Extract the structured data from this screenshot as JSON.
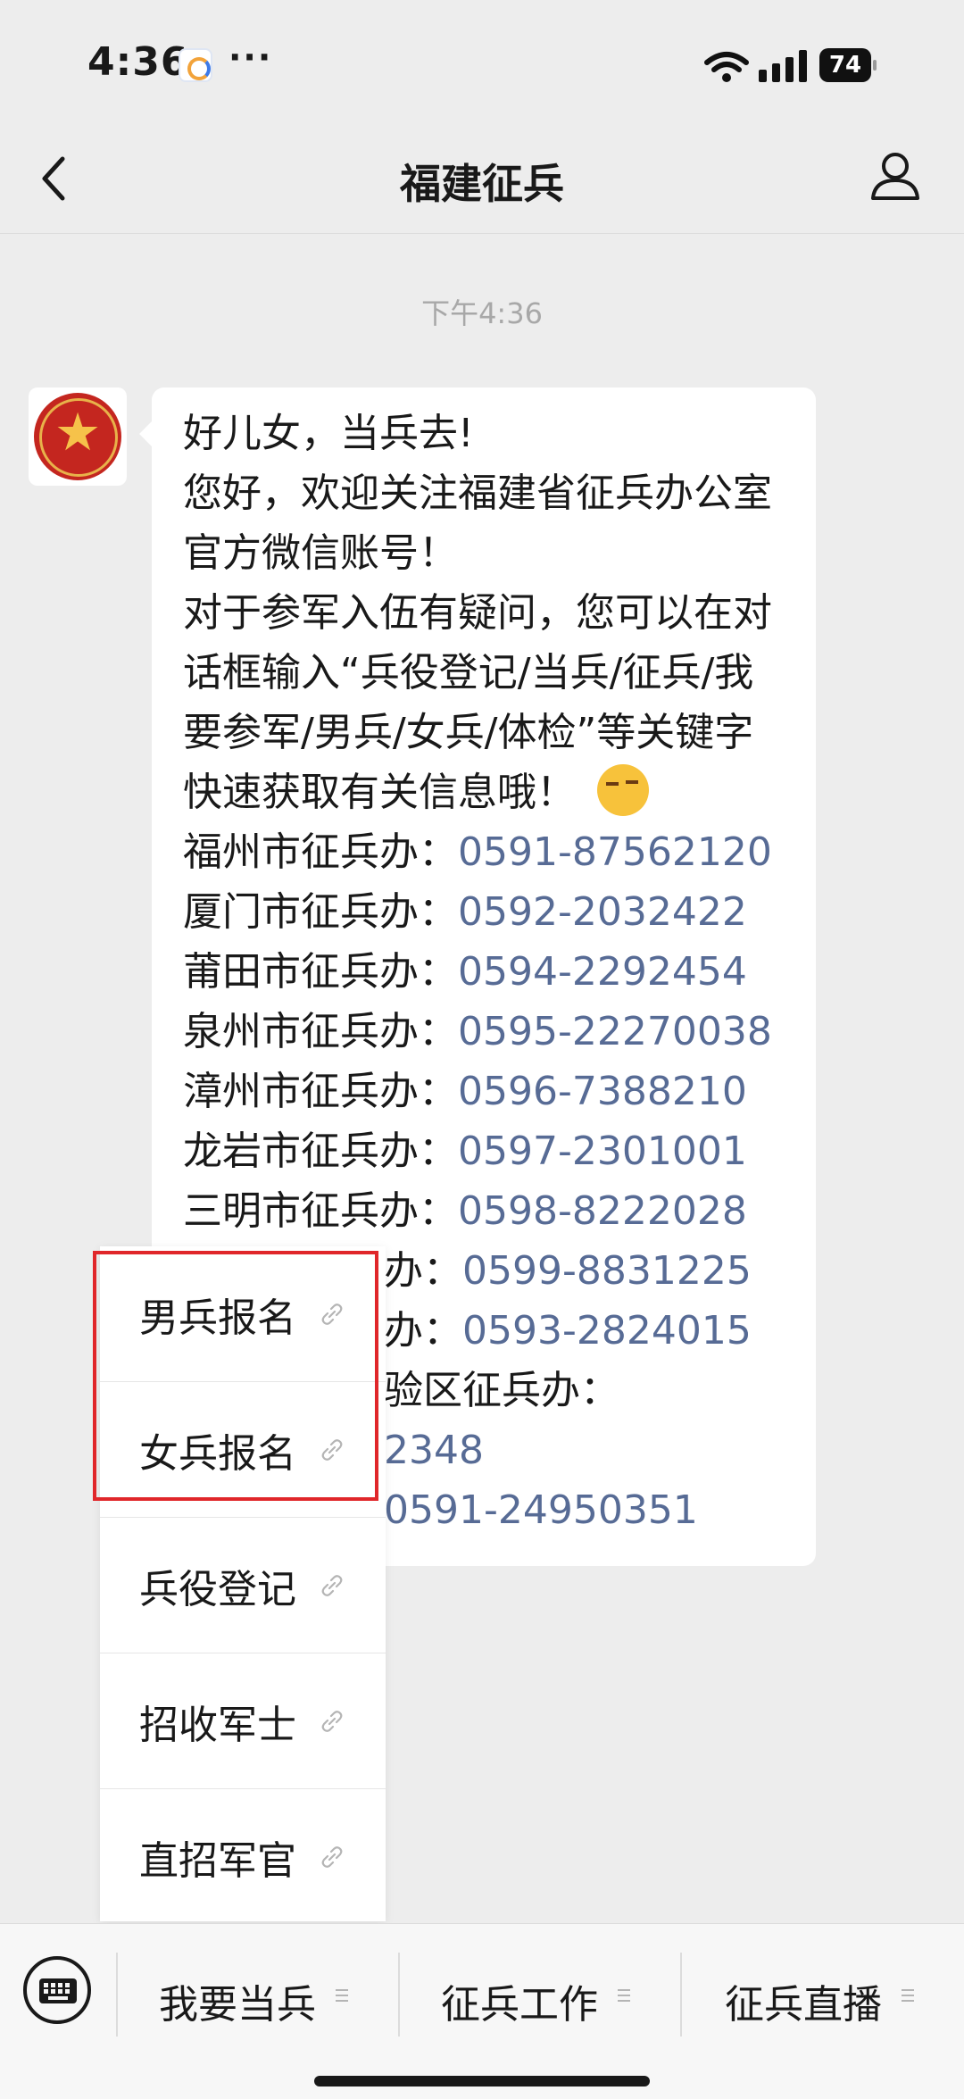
{
  "status_bar": {
    "time": "4:36",
    "more": "···",
    "battery": "74",
    "icons": [
      "app-notification-icon",
      "wifi-icon",
      "cellular-signal-icon",
      "battery-icon"
    ]
  },
  "nav": {
    "title": "福建征兵",
    "back_icon": "chevron-left-icon",
    "profile_icon": "person-icon"
  },
  "chat": {
    "timestamp": "下午4:36",
    "message": {
      "lines": [
        "好儿女，当兵去!",
        "您好，欢迎关注福建省征兵办公室",
        "官方微信账号！",
        "对于参军入伍有疑问，您可以在对",
        "话框输入“兵役登记/当兵/征兵/我",
        "要参军/男兵/女兵/体检”等关键字",
        "快速获取有关信息哦！"
      ],
      "emoji": "smirk-emoji",
      "offices": [
        {
          "label": "福州市征兵办：",
          "phone": "0591-87562120"
        },
        {
          "label": "厦门市征兵办：",
          "phone": "0592-2032422"
        },
        {
          "label": "莆田市征兵办：",
          "phone": "0594-2292454"
        },
        {
          "label": "泉州市征兵办：",
          "phone": "0595-22270038"
        },
        {
          "label": "漳州市征兵办：",
          "phone": "0596-7388210"
        },
        {
          "label": "龙岩市征兵办：",
          "phone": "0597-2301001"
        },
        {
          "label": "三明市征兵办：",
          "phone": "0598-8222028"
        },
        {
          "label": "办：",
          "phone": "0599-8831225"
        },
        {
          "label": "办：",
          "phone": "0593-2824015"
        }
      ],
      "partial_lines": {
        "line1": "验区征兵办：",
        "line2_phone": "2348",
        "line3_phone": "0591-24950351"
      }
    }
  },
  "popup_menu": {
    "items": [
      {
        "label": "男兵报名",
        "icon": "link-icon"
      },
      {
        "label": "女兵报名",
        "icon": "link-icon"
      },
      {
        "label": "兵役登记",
        "icon": "link-icon"
      },
      {
        "label": "招收军士",
        "icon": "link-icon"
      },
      {
        "label": "直招军官",
        "icon": "link-icon"
      }
    ],
    "highlight_color": "#e0262a"
  },
  "bottom_bar": {
    "keyboard_icon": "keyboard-icon",
    "menus": [
      {
        "label": "我要当兵",
        "icon": "menu-lines-icon"
      },
      {
        "label": "征兵工作",
        "icon": "menu-lines-icon"
      },
      {
        "label": "征兵直播",
        "icon": "menu-lines-icon"
      }
    ]
  },
  "colors": {
    "background": "#ededed",
    "link": "#576b95",
    "bubble": "#ffffff",
    "highlight": "#e0262a"
  }
}
